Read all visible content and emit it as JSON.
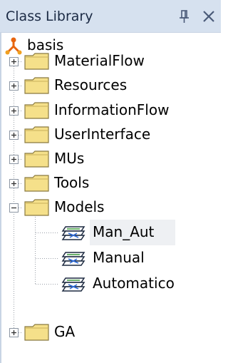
{
  "panel": {
    "title": "Class Library"
  },
  "tree": {
    "root": {
      "label": "basis"
    },
    "folders": [
      {
        "label": "MaterialFlow",
        "expanded": false
      },
      {
        "label": "Resources",
        "expanded": false
      },
      {
        "label": "InformationFlow",
        "expanded": false
      },
      {
        "label": "UserInterface",
        "expanded": false
      },
      {
        "label": "MUs",
        "expanded": false
      },
      {
        "label": "Tools",
        "expanded": false
      },
      {
        "label": "Models",
        "expanded": true
      }
    ],
    "models": [
      {
        "label": "Man_Aut",
        "selected": true
      },
      {
        "label": "Manual",
        "selected": false
      },
      {
        "label": "Automatico",
        "selected": false
      }
    ],
    "last_folder": {
      "label": "GA",
      "expanded": false
    }
  },
  "colors": {
    "title_bar": "#d6e1ef",
    "folder_fill": "#f5e08a",
    "root_icon": "#e8650f",
    "selection": "#eef0f3"
  },
  "icons": {
    "pin": "pin-icon",
    "close": "close-icon",
    "folder": "folder-icon",
    "model": "model-icon",
    "root": "root-icon"
  }
}
